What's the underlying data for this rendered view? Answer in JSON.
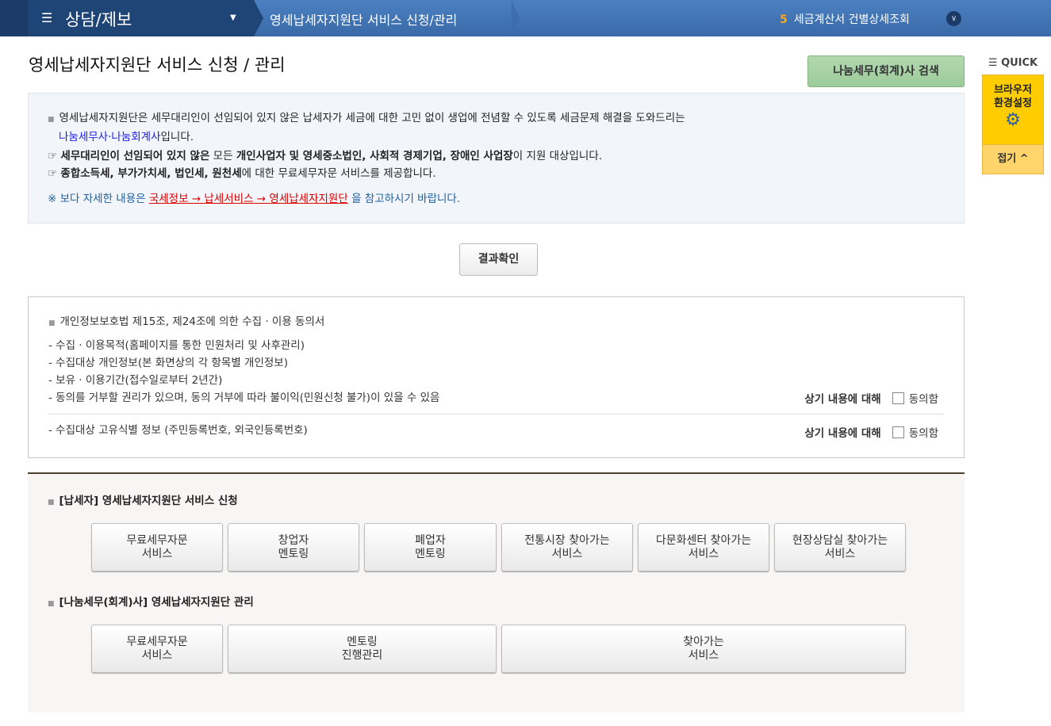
{
  "topbar": {
    "menu_title": "상담/제보",
    "breadcrumb": "영세납세자지원단 서비스 신청/관리",
    "recent_count": "5",
    "recent_label": "세금계산서 건별상세조회"
  },
  "page": {
    "title": "영세납세자지원단 서비스 신청 / 관리",
    "search_button": "나눔세무(회계)사 검색",
    "result_button": "결과확인"
  },
  "info": {
    "line1": "영세납세자지원단은 세무대리인이 선임되어 있지 않은 납세자가 세금에 대한 고민 없이 생업에 전념할 수 있도록 세금문제 해결을 도와드리는",
    "line1_link": "나눔세무사·나눔회계사",
    "line1_end": "입니다.",
    "line2_a": "세무대리인이 선임되어 있지 않은",
    "line2_b": " 모든 ",
    "line2_c": "개인사업자 및 영세중소법인, 사회적 경제기업, 장애인 사업장",
    "line2_d": "이 지원 대상입니다.",
    "line3_a": "종합소득세, 부가가치세, 법인세, 원천세",
    "line3_b": "에 대한 무료세무자문 서비스를 제공합니다.",
    "note_a": "※ 보다 자세한 내용은 ",
    "note_link": "국세정보 → 납세서비스 → 영세납세자지원단",
    "note_b": " 을 참고하시기 바랍니다."
  },
  "consent": {
    "title": "개인정보보호법 제15조, 제24조에 의한 수집 · 이용 동의서",
    "items": [
      "- 수집 · 이용목적(홈페이지를 통한 민원처리 및 사후관리)",
      "- 수집대상 개인정보(본 화면상의 각 항목별 개인정보)",
      "- 보유 · 이용기간(접수일로부터 2년간)",
      "- 동의를 거부할 권리가 있으며, 동의 거부에 따라 불이익(민원신청 불가)이 있을 수 있음"
    ],
    "unique": "- 수집대상 고유식별 정보 (주민등록번호, 외국인등록번호)",
    "agree_prefix": "상기 내용에 대해",
    "agree_label": "동의함"
  },
  "apply": {
    "title": "[납세자] 영세납세자지원단 서비스 신청",
    "buttons": [
      "무료세무자문\n서비스",
      "창업자\n멘토링",
      "폐업자\n멘토링",
      "전통시장 찾아가는\n서비스",
      "다문화센터 찾아가는\n서비스",
      "현장상담실 찾아가는\n서비스"
    ]
  },
  "manage": {
    "title": "[나눔세무(회계)사] 영세납세자지원단 관리",
    "buttons": [
      "무료세무자문\n서비스",
      "멘토링\n진행관리",
      "찾아가는\n서비스"
    ]
  },
  "quick": {
    "label": "QUICK",
    "browser_line1": "브라우저",
    "browser_line2": "환경설정",
    "fold": "접기"
  }
}
